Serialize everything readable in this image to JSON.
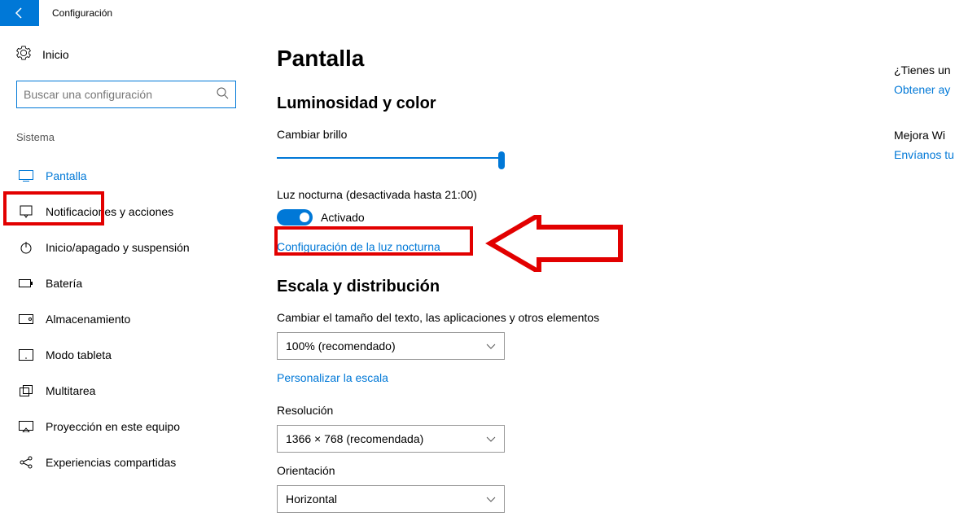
{
  "app": {
    "title": "Configuración"
  },
  "sidebar": {
    "home": "Inicio",
    "search_placeholder": "Buscar una configuración",
    "category": "Sistema",
    "items": [
      {
        "label": "Pantalla"
      },
      {
        "label": "Notificaciones y acciones"
      },
      {
        "label": "Inicio/apagado y suspensión"
      },
      {
        "label": "Batería"
      },
      {
        "label": "Almacenamiento"
      },
      {
        "label": "Modo tableta"
      },
      {
        "label": "Multitarea"
      },
      {
        "label": "Proyección en este equipo"
      },
      {
        "label": "Experiencias compartidas"
      }
    ]
  },
  "main": {
    "title": "Pantalla",
    "section1_title": "Luminosidad y color",
    "brightness_label": "Cambiar brillo",
    "nightlight_label": "Luz nocturna (desactivada hasta 21:00)",
    "toggle_state": "Activado",
    "nightlight_link": "Configuración de la luz nocturna",
    "section2_title": "Escala y distribución",
    "scale_label": "Cambiar el tamaño del texto, las aplicaciones y otros elementos",
    "scale_value": "100% (recomendado)",
    "scale_link": "Personalizar la escala",
    "resolution_label": "Resolución",
    "resolution_value": "1366 × 768 (recomendada)",
    "orientation_label": "Orientación",
    "orientation_value": "Horizontal"
  },
  "aside": {
    "question": "¿Tienes un",
    "help_link": "Obtener ay",
    "improve": "Mejora Wi",
    "feedback_link": "Envíanos tu"
  }
}
